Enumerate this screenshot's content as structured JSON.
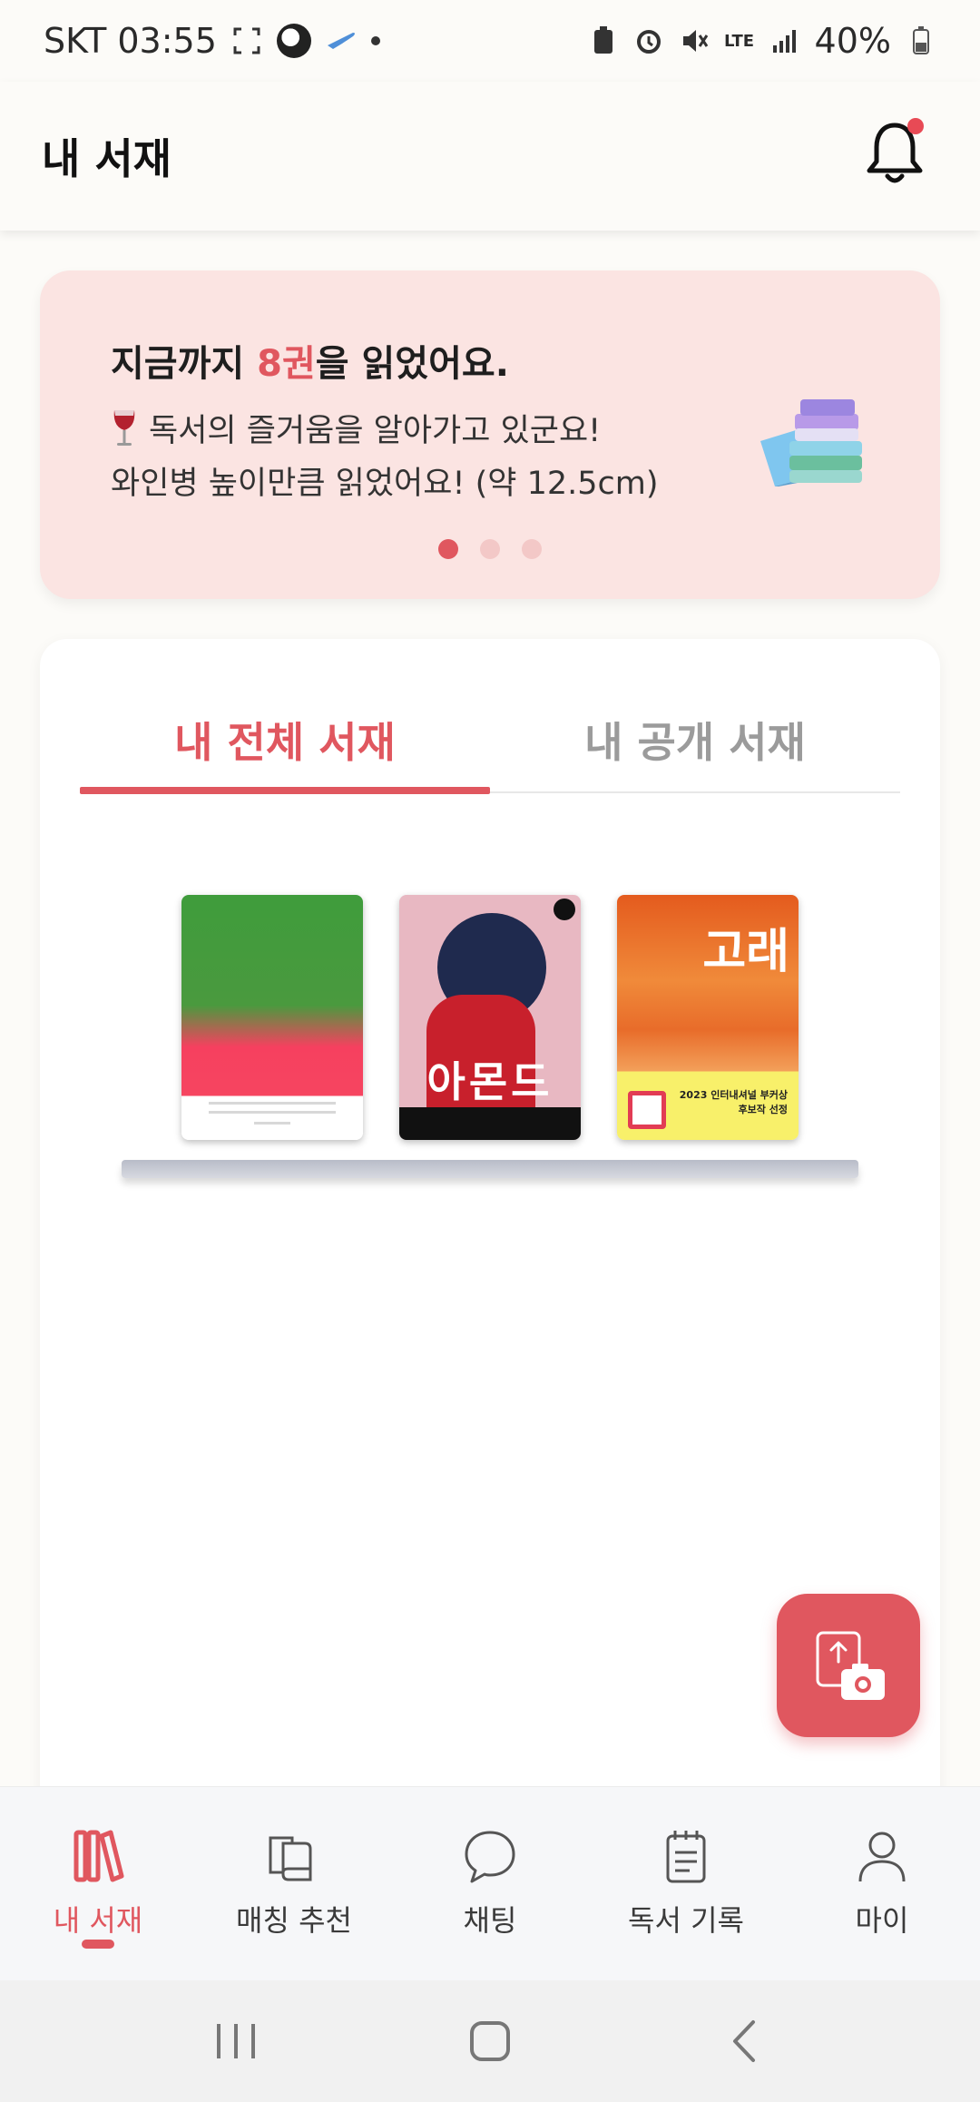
{
  "status_bar": {
    "carrier_time": "SKT 03:55",
    "battery": "40%",
    "network": "LTE"
  },
  "header": {
    "title": "내 서재"
  },
  "banner": {
    "title_prefix": "지금까지 ",
    "count": "8권",
    "title_suffix": "을 읽었어요.",
    "line1": "독서의 즐거움을 알아가고 있군요!",
    "line2": "와인병 높이만큼 읽었어요! (약 12.5cm)",
    "page_index": 1,
    "page_count": 3
  },
  "tabs": [
    {
      "label": "내 전체 서재",
      "active": true
    },
    {
      "label": "내 공개 서재",
      "active": false
    }
  ],
  "books": [
    {
      "cover": "green-red"
    },
    {
      "cover": "portrait",
      "title": "아몬드"
    },
    {
      "cover": "orange",
      "title": "고래",
      "sub": "2023 인터내셔널 부커상\n후보작 선정"
    }
  ],
  "nav": [
    {
      "label": "내 서재",
      "icon": "library-icon",
      "active": true
    },
    {
      "label": "매칭 추천",
      "icon": "books-icon",
      "active": false
    },
    {
      "label": "채팅",
      "icon": "chat-icon",
      "active": false
    },
    {
      "label": "독서 기록",
      "icon": "notepad-icon",
      "active": false
    },
    {
      "label": "마이",
      "icon": "person-icon",
      "active": false
    }
  ],
  "colors": {
    "accent": "#e0575f",
    "banner_bg": "#fbe4e2"
  }
}
